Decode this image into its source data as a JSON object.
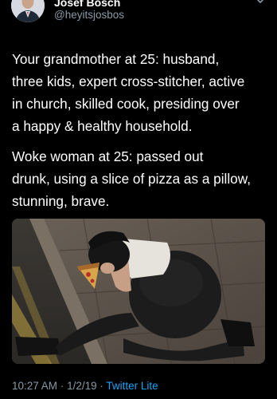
{
  "user": {
    "display_name": "Josef Bosch",
    "handle": "@heyitsjosbos"
  },
  "tweet": {
    "paragraph_1_lines": [
      "Your grandmother at 25: husband,",
      "three kids, expert cross-stitcher, active",
      "in church, skilled cook, presiding over",
      "a happy & healthy household."
    ],
    "paragraph_2_lines": [
      "Woke woman at 25: passed out",
      "drunk, using a slice of pizza as a pillow,",
      "stunning, brave."
    ]
  },
  "meta": {
    "time": "10:27 AM",
    "separator": "·",
    "date": "1/2/19",
    "source": "Twitter Lite"
  },
  "icons": {
    "menu": "chevron-down-icon"
  },
  "colors": {
    "background": "#000000",
    "text": "#ffffff",
    "secondary_text": "#8899a6",
    "link": "#1da1f2"
  }
}
